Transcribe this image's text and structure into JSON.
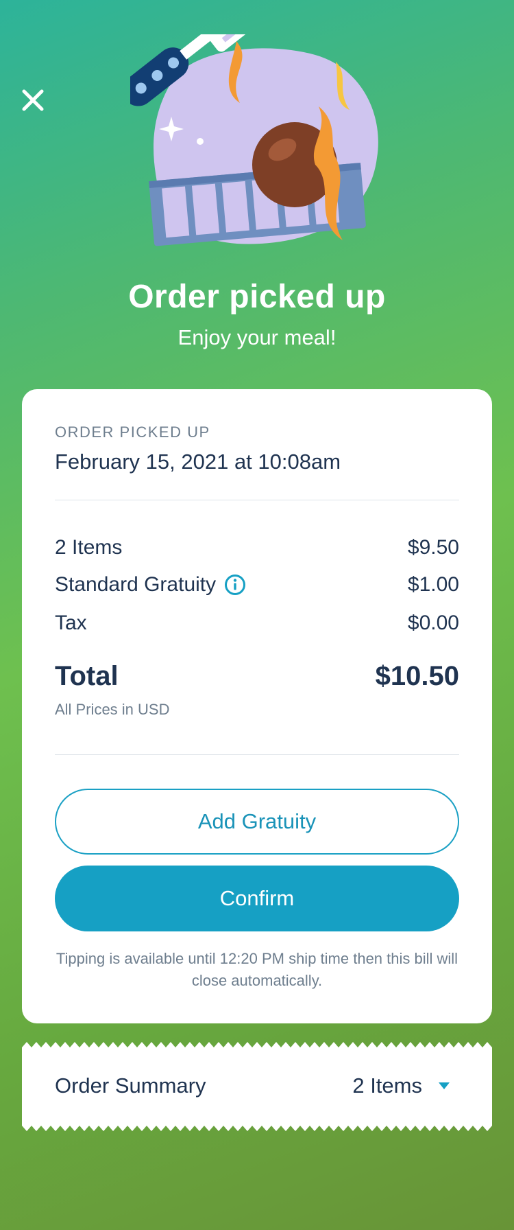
{
  "header": {
    "title": "Order picked up",
    "subtitle": "Enjoy your meal!"
  },
  "icons": {
    "close": "close-icon",
    "hero": "grill-spatula-illustration",
    "info": "info-icon",
    "dropdown": "caret-down-icon"
  },
  "receipt": {
    "status_label": "ORDER PICKED UP",
    "timestamp": "February 15, 2021 at 10:08am",
    "lines": [
      {
        "label": "2 Items",
        "amount": "$9.50"
      },
      {
        "label": "Standard Gratuity",
        "amount": "$1.00"
      },
      {
        "label": "Tax",
        "amount": "$0.00"
      }
    ],
    "total_label": "Total",
    "total_amount": "$10.50",
    "currency_note": "All Prices in USD"
  },
  "actions": {
    "add_gratuity": "Add Gratuity",
    "confirm": "Confirm"
  },
  "tip_note": "Tipping is available until 12:20 PM ship time then this bill will close automatically.",
  "summary": {
    "label": "Order Summary",
    "count": "2 Items"
  },
  "colors": {
    "accent": "#16a0c4",
    "text_primary": "#1f3350",
    "text_secondary": "#6e7e8e"
  }
}
